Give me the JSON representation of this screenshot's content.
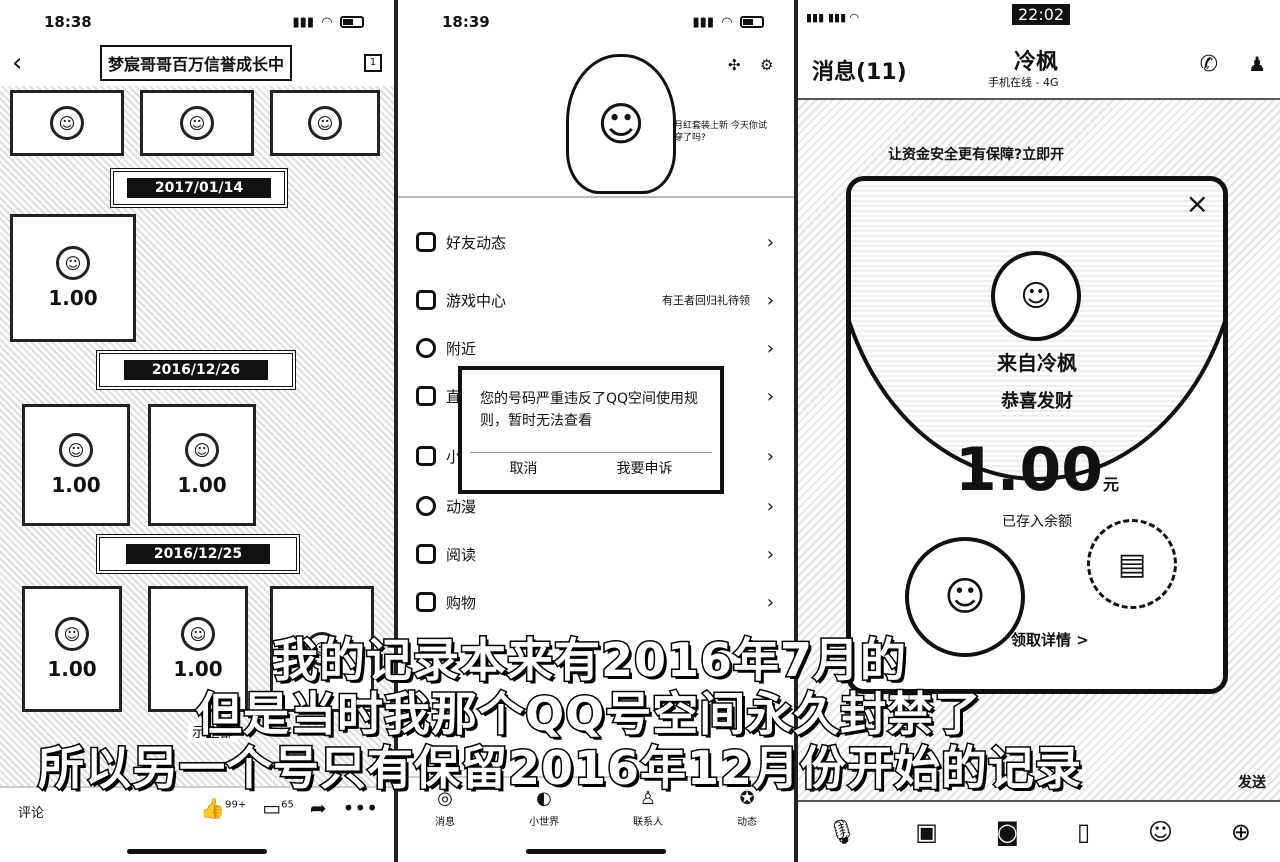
{
  "panel1": {
    "status_time": "18:38",
    "title": "梦宸哥哥百万信誉成长中",
    "calendar_label": "1",
    "dates": [
      "2017/01/14",
      "2016/12/26",
      "2016/12/25"
    ],
    "envelope_amounts": [
      "1.00",
      "1.00",
      "1.00",
      "1.00",
      "1.00"
    ],
    "show_all": "示全部",
    "comment_label": "评论",
    "like_count": "99+",
    "comment_count": "65"
  },
  "panel2": {
    "status_time": "18:39",
    "bubble_text": "月红套装上新 今天你试穿了吗?",
    "menu": [
      {
        "label": "好友动态"
      },
      {
        "label": "游戏中心",
        "note": "有王者回归礼待领"
      },
      {
        "label": "附近"
      },
      {
        "label": "直"
      },
      {
        "label": "小"
      },
      {
        "label": "动漫"
      },
      {
        "label": "阅读"
      },
      {
        "label": "购物"
      }
    ],
    "dialog": {
      "message": "您的号码严重违反了QQ空间使用规则，暂时无法查看",
      "cancel": "取消",
      "appeal": "我要申诉"
    },
    "tabs": [
      "消息",
      "小世界",
      "联系人",
      "动态"
    ]
  },
  "panel3": {
    "status_time": "22:02",
    "back_label": "消息(11)",
    "contact_name": "冷枫",
    "contact_sub": "手机在线 - 4G",
    "notice": "让资金安全更有保障?立即开",
    "redpacket": {
      "from": "来自冷枫",
      "wish": "恭喜发财",
      "amount": "1.00",
      "unit": "元",
      "saved": "已存入余额",
      "detail": "领取详情 >"
    },
    "send_label": "发送"
  },
  "captions": [
    "我的记录本来有2016年7月的",
    "但是当时我那个QQ号空间永久封禁了",
    "所以另一个号只有保留2016年12月份开始的记录"
  ]
}
